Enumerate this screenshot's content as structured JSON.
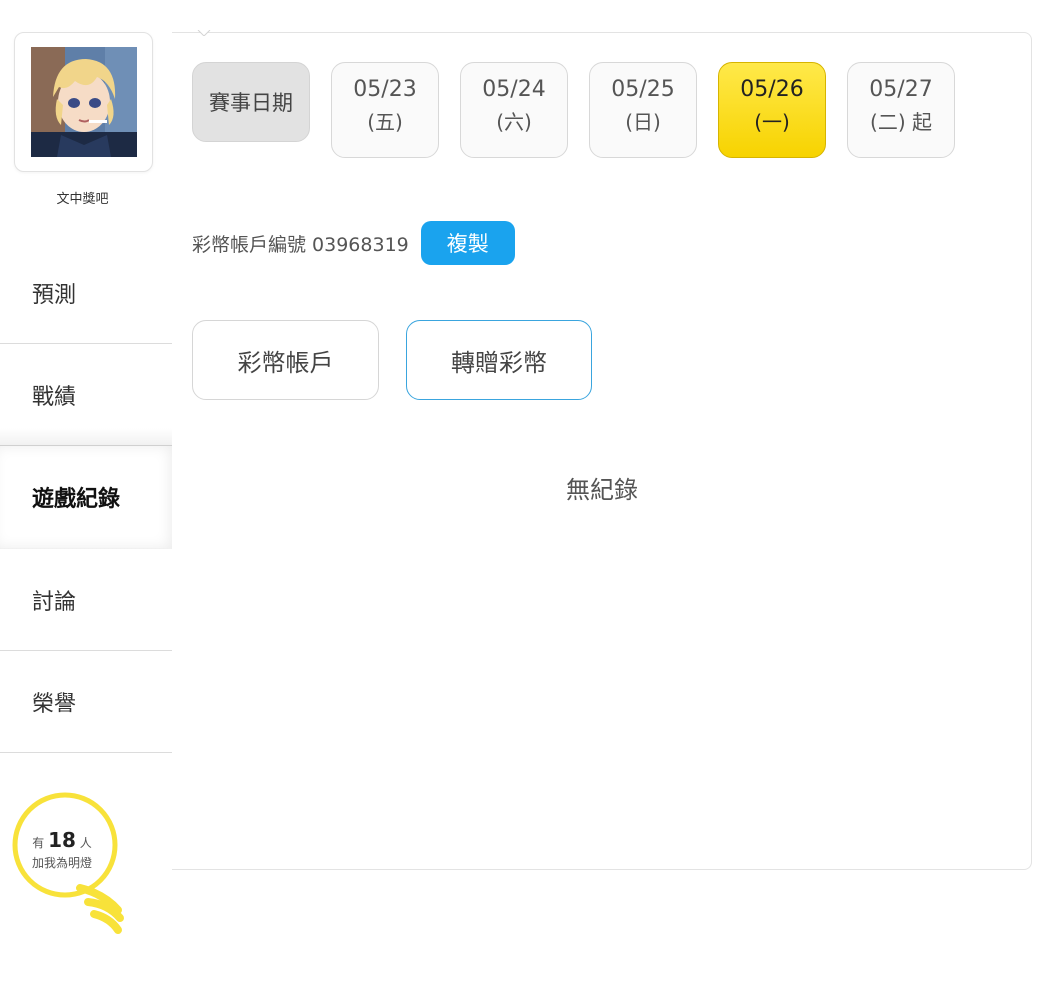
{
  "profile": {
    "username": "文中獎吧",
    "avatar_icon": "anime-avatar"
  },
  "nav": {
    "items": [
      {
        "label": "預測",
        "active": false
      },
      {
        "label": "戰績",
        "active": false
      },
      {
        "label": "遊戲紀錄",
        "active": true
      },
      {
        "label": "討論",
        "active": false
      },
      {
        "label": "榮譽",
        "active": false
      }
    ]
  },
  "bulb": {
    "prefix": "有",
    "count": "18",
    "suffix": "人",
    "caption": "加我為明燈",
    "icon": "lightbulb-icon",
    "color": "#f8e23a"
  },
  "date_filter": {
    "label": "賽事日期",
    "dates": [
      {
        "date": "05/23",
        "weekday": "(五)",
        "active": false
      },
      {
        "date": "05/24",
        "weekday": "(六)",
        "active": false
      },
      {
        "date": "05/25",
        "weekday": "(日)",
        "active": false
      },
      {
        "date": "05/26",
        "weekday": "(一)",
        "active": true
      },
      {
        "date": "05/27",
        "weekday": "(二) 起",
        "active": false
      }
    ],
    "active_color": "#f7d300"
  },
  "account": {
    "label": "彩幣帳戶編號 03968319",
    "copy_label": "複製",
    "copy_color": "#1aa3ee"
  },
  "tabs": {
    "account_tab": "彩幣帳戶",
    "transfer_tab": "轉贈彩幣",
    "selected": "轉贈彩幣"
  },
  "empty_message": "無紀錄"
}
